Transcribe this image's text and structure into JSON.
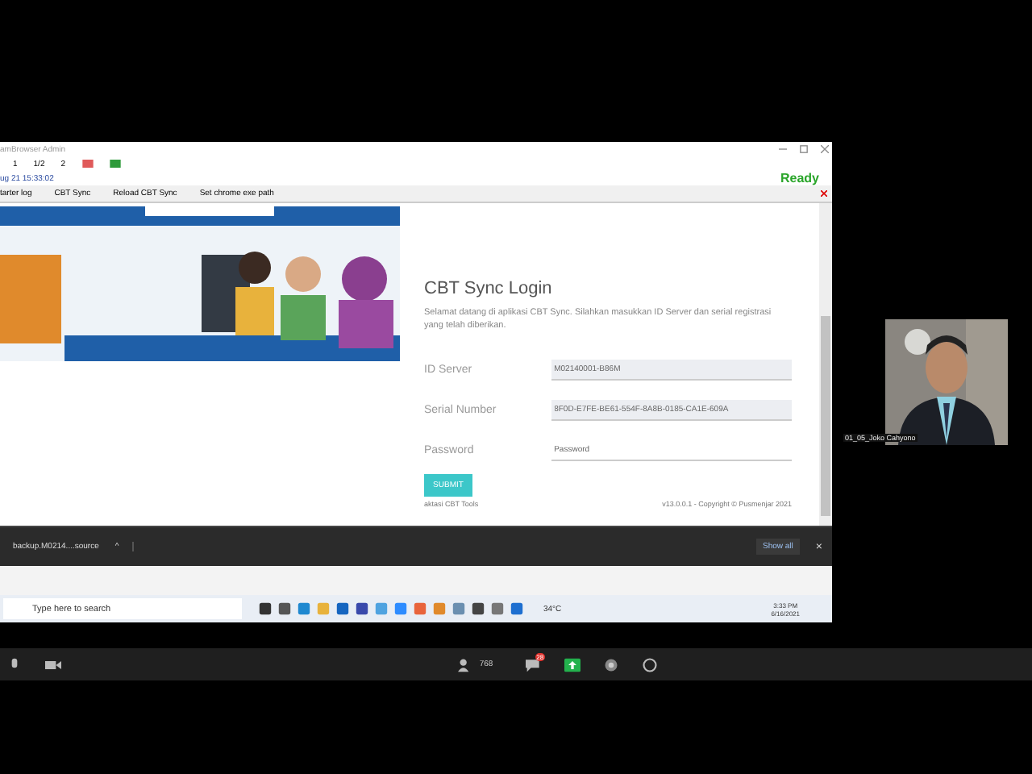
{
  "app_window": {
    "title": "amBrowser Admin",
    "toolbar": [
      "1",
      "1/2",
      "2"
    ],
    "timestamp": "ug 21 15:33:02",
    "status": "Ready",
    "menu": [
      "tarter log",
      "CBT Sync",
      "Reload CBT Sync",
      "Set chrome exe path"
    ]
  },
  "login": {
    "title": "CBT Sync Login",
    "intro": "Selamat datang di aplikasi CBT Sync. Silahkan masukkan ID Server dan serial registrasi yang telah diberikan.",
    "fields": [
      {
        "label": "ID Server",
        "value": "M02140001-B86M"
      },
      {
        "label": "Serial Number",
        "value": "8F0D-E7FE-BE61-554F-8A8B-0185-CA1E-609A"
      },
      {
        "label": "Password",
        "placeholder": "Password"
      }
    ],
    "submit": "SUBMIT",
    "footer_left": "aktasi CBT Tools",
    "footer_right": "v13.0.0.1 - Copyright © Pusmenjar 2021"
  },
  "downloads": {
    "file": "backup.M0214....source",
    "caret": "^",
    "show_all": "Show all",
    "close": "×"
  },
  "taskbar": {
    "search_placeholder": "Type here to search",
    "temperature": "34°C",
    "time": "3:33 PM",
    "date": "6/16/2021"
  },
  "video": {
    "name": "01_05_Joko Cahyono"
  },
  "meeting_bar": {
    "participants": "768",
    "chat_badge": "28"
  }
}
